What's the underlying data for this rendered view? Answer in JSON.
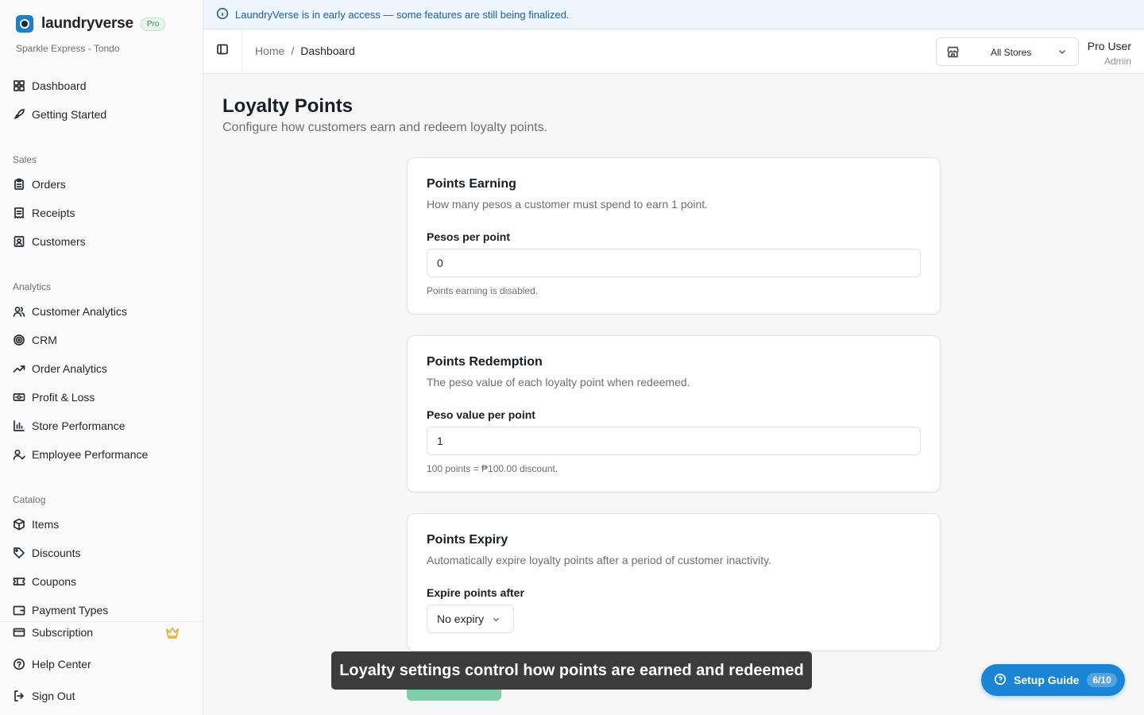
{
  "brand": {
    "name": "laundryverse",
    "badge": "Pro",
    "store": "Sparkle Express - Tondo"
  },
  "nav": {
    "top": [
      {
        "label": "Dashboard",
        "icon": "grid-icon"
      },
      {
        "label": "Getting Started",
        "icon": "rocket-icon"
      }
    ],
    "sales_title": "Sales",
    "sales": [
      {
        "label": "Orders",
        "icon": "clipboard-icon"
      },
      {
        "label": "Receipts",
        "icon": "receipt-icon"
      },
      {
        "label": "Customers",
        "icon": "contact-icon"
      }
    ],
    "analytics_title": "Analytics",
    "analytics": [
      {
        "label": "Customer Analytics",
        "icon": "users-icon"
      },
      {
        "label": "CRM",
        "icon": "target-icon"
      },
      {
        "label": "Order Analytics",
        "icon": "trend-icon"
      },
      {
        "label": "Profit & Loss",
        "icon": "banknote-icon"
      },
      {
        "label": "Store Performance",
        "icon": "bar-chart-icon"
      },
      {
        "label": "Employee Performance",
        "icon": "user-check-icon"
      }
    ],
    "catalog_title": "Catalog",
    "catalog": [
      {
        "label": "Items",
        "icon": "package-icon"
      },
      {
        "label": "Discounts",
        "icon": "tag-icon"
      },
      {
        "label": "Coupons",
        "icon": "ticket-icon"
      },
      {
        "label": "Payment Types",
        "icon": "wallet-icon"
      }
    ],
    "bottom": [
      {
        "label": "Subscription",
        "icon": "credit-card-icon"
      },
      {
        "label": "Help Center",
        "icon": "help-icon"
      },
      {
        "label": "Sign Out",
        "icon": "logout-icon"
      }
    ]
  },
  "banner": {
    "text": "LaundryVerse is in early access — some features are still being finalized."
  },
  "header": {
    "breadcrumb_home": "Home",
    "breadcrumb_sep": "/",
    "breadcrumb_current": "Dashboard",
    "store_select": "All Stores",
    "user_name": "Pro User",
    "user_role": "Admin"
  },
  "page": {
    "title": "Loyalty Points",
    "subtitle": "Configure how customers earn and redeem loyalty points."
  },
  "earning": {
    "title": "Points Earning",
    "desc": "How many pesos a customer must spend to earn 1 point.",
    "label": "Pesos per point",
    "value": "0",
    "hint": "Points earning is disabled."
  },
  "redemption": {
    "title": "Points Redemption",
    "desc": "The peso value of each loyalty point when redeemed.",
    "label": "Peso value per point",
    "value": "1",
    "hint": "100 points = ₱100.00 discount."
  },
  "expiry": {
    "title": "Points Expiry",
    "desc": "Automatically expire loyalty points after a period of customer inactivity.",
    "label": "Expire points after",
    "value": "No expiry"
  },
  "toast": {
    "text": "Loyalty settings control how points are earned and redeemed"
  },
  "setup_guide": {
    "label": "Setup Guide",
    "count": "6/10"
  },
  "colors": {
    "accent": "#1a84d6",
    "save_button": "#7fcdaa",
    "banner_text": "#1d5fa8"
  }
}
